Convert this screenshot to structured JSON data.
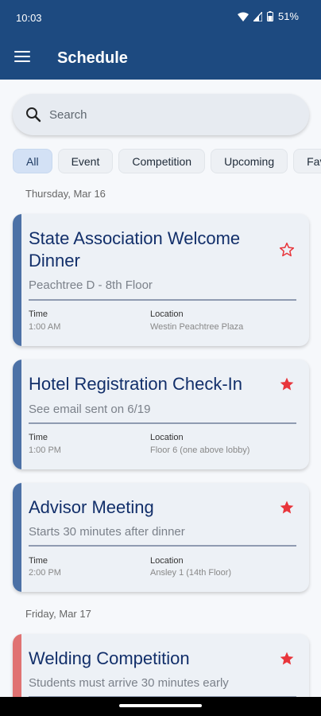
{
  "status_bar": {
    "time": "10:03",
    "battery": "51%"
  },
  "app_bar": {
    "title": "Schedule"
  },
  "search": {
    "placeholder": "Search"
  },
  "filters": [
    "All",
    "Event",
    "Competition",
    "Upcoming",
    "Favorites"
  ],
  "selected_filter": "All",
  "days": [
    {
      "date": "Thursday, Mar 16",
      "events": [
        {
          "title": "State Association Welcome Dinner",
          "subtitle": "Peachtree D - 8th Floor",
          "time_label": "Time",
          "time": "1:00 AM",
          "location_label": "Location",
          "location": "Westin Peachtree Plaza",
          "favorite": false,
          "accent": "#4c71a6"
        },
        {
          "title": "Hotel Registration Check-In",
          "subtitle": "See email sent on 6/19",
          "time_label": "Time",
          "time": "1:00 PM",
          "location_label": "Location",
          "location": "Floor 6 (one above lobby)",
          "favorite": true,
          "accent": "#4c71a6"
        },
        {
          "title": "Advisor Meeting",
          "subtitle": "Starts 30 minutes after dinner",
          "time_label": "Time",
          "time": "2:00 PM",
          "location_label": "Location",
          "location": "Ansley 1 (14th Floor)",
          "favorite": true,
          "accent": "#4c71a6"
        }
      ]
    },
    {
      "date": "Friday, Mar 17",
      "events": [
        {
          "title": "Welding Competition",
          "subtitle": "Students must arrive 30 minutes early",
          "favorite": true,
          "accent": "#e07272"
        }
      ]
    }
  ],
  "colors": {
    "primary": "#1d4a80",
    "star": "#e8353b",
    "title": "#122f6a"
  }
}
